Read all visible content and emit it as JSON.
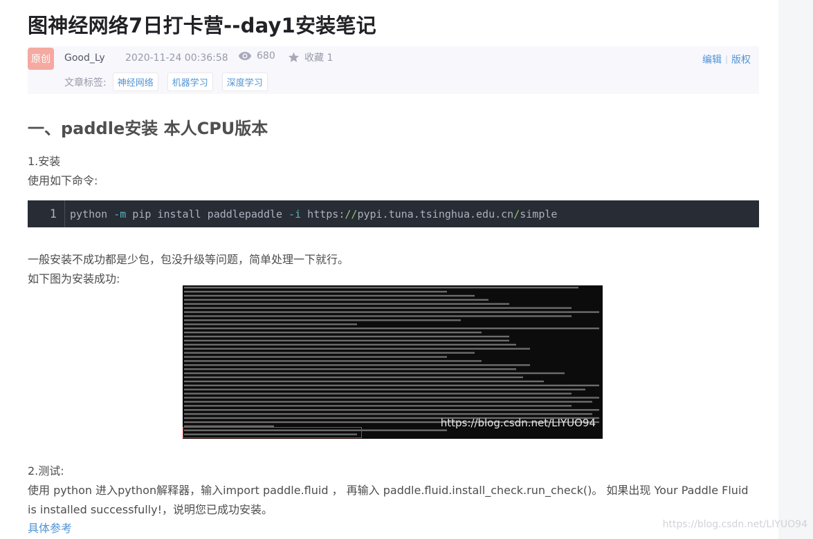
{
  "article": {
    "title": "图神经网络7日打卡营--day1安装笔记",
    "meta": {
      "original_badge": "原创",
      "author": "Good_Ly",
      "datetime": "2020-11-24 00:36:58",
      "views": "680",
      "collect": "收藏 1",
      "edit_label": "编辑",
      "copyright_label": "版权",
      "tags_label": "文章标签:",
      "tags": [
        "神经网络",
        "机器学习",
        "深度学习"
      ]
    },
    "section1_heading": "一、paddle安装 本人CPU版本",
    "install_label": "1.安装",
    "cmd_intro": "使用如下命令:",
    "code": {
      "line_number": "1",
      "parts": {
        "p1": "python ",
        "p2": "-m",
        "p3": " pip install paddlepaddle ",
        "p4": "-i",
        "p5": " https:",
        "p6": "//",
        "p7": "pypi.tuna.tsinghua.edu.cn",
        "p8": "/",
        "p9": "simple"
      }
    },
    "note": "一般安装不成功都是少包，包没升级等问题，简单处理一下就行。",
    "success_intro": "如下图为安装成功:",
    "screenshot_watermark": "https://blog.csdn.net/LIYUO94",
    "test_label": "2.测试:",
    "test_line1": "使用 python 进入python解释器，输入import paddle.fluid ， 再输入 paddle.fluid.install_check.run_check()。 如果出现 Your Paddle Fluid",
    "test_line2": "is installed successfully!，说明您已成功安装。",
    "ref_link": "具体参考"
  },
  "page_watermark": "https://blog.csdn.net/LIYUO94",
  "colors": {
    "link": "#5094d5",
    "code_bg": "#282c34",
    "badge": "#f4a9a1"
  }
}
